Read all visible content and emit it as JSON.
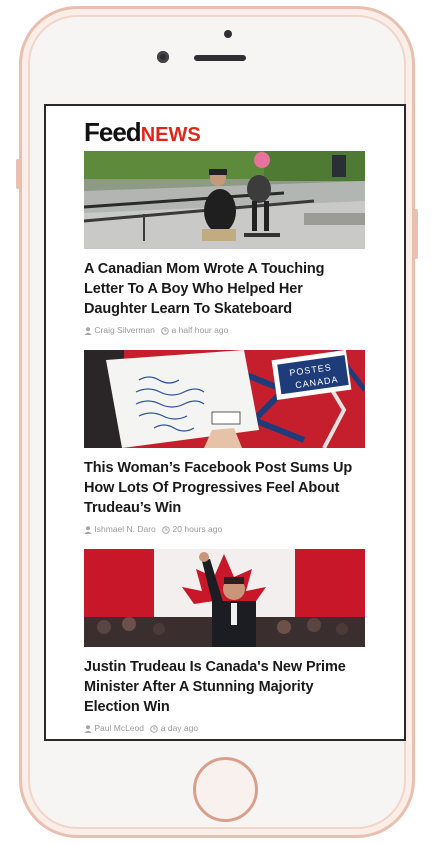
{
  "app": {
    "logo_primary": "Feed",
    "logo_secondary": "NEWS"
  },
  "articles": [
    {
      "title": "A Canadian Mom Wrote A Touching Letter To A Boy Who Helped Her Daughter Learn To Skateboard",
      "author": "Craig Silverman",
      "time": "a half hour ago"
    },
    {
      "title": "This Woman’s Facebook Post Sums Up How Lots Of Progressives Feel About Trudeau’s Win",
      "author": "Ishmael N. Daro",
      "time": "20 hours ago",
      "image_text": {
        "stamp_line1": "POSTES",
        "stamp_line2": "CANADA"
      }
    },
    {
      "title": "Justin Trudeau Is Canada's New Prime Minister After A Stunning Majority Election Win",
      "author": "Paul McLeod",
      "time": "a day ago"
    }
  ],
  "colors": {
    "accent": "#e0261a",
    "phone_frame": "#e9bfb0",
    "meta_text": "#9a9a9a"
  }
}
